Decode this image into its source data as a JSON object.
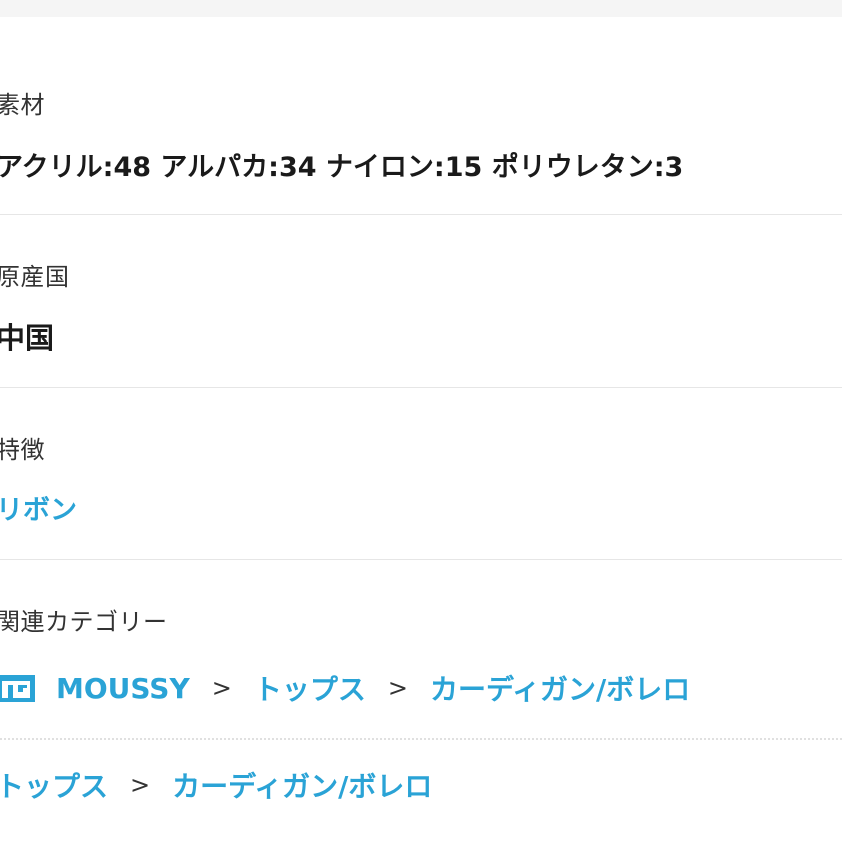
{
  "material": {
    "label": "素材",
    "value": "アクリル:48 アルパカ:34 ナイロン:15 ポリウレタン:3"
  },
  "origin": {
    "label": "原産国",
    "value": "中国"
  },
  "feature": {
    "label": "特徴",
    "value": "リボン"
  },
  "related": {
    "label": "関連カテゴリー",
    "row1": {
      "icon": "shop-icon",
      "items": [
        "MOUSSY",
        "トップス",
        "カーディガン/ボレロ"
      ],
      "separator": ">"
    },
    "row2": {
      "items": [
        "トップス",
        "カーディガン/ボレロ"
      ],
      "separator": ">"
    }
  },
  "colors": {
    "link": "#2aa3d6",
    "label": "#333333",
    "value": "#1a1a1a",
    "divider": "#e6e6e6"
  }
}
